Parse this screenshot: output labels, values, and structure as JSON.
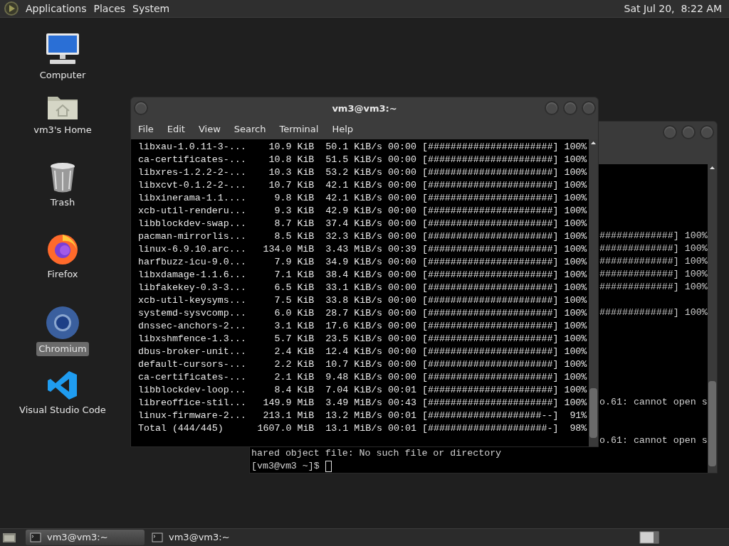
{
  "top_panel": {
    "menus": [
      "Applications",
      "Places",
      "System"
    ],
    "clock": "Sat Jul 20,  8:22 AM"
  },
  "desktop_icons": [
    {
      "label": "Computer",
      "kind": "computer",
      "selected": false
    },
    {
      "label": "vm3's Home",
      "kind": "home",
      "selected": false
    },
    {
      "label": "Trash",
      "kind": "trash",
      "selected": false
    },
    {
      "label": "Firefox",
      "kind": "firefox",
      "selected": false
    },
    {
      "label": "Chromium",
      "kind": "chromium",
      "selected": true
    },
    {
      "label": "Visual Studio Code",
      "kind": "vscode",
      "selected": false
    }
  ],
  "back_window": {
    "lines": [
      {
        "kind": "clipped",
        "text": "#############] 100%"
      },
      {
        "kind": "clipped",
        "text": "#############] 100%"
      },
      {
        "kind": "clipped",
        "text": "#############] 100%"
      },
      {
        "kind": "clipped",
        "text": "#############] 100%"
      },
      {
        "kind": "clipped",
        "text": "#############] 100%"
      },
      {
        "kind": "blank"
      },
      {
        "kind": "clipped",
        "text": "#############] 100%"
      },
      {
        "kind": "blank"
      },
      {
        "kind": "blank"
      },
      {
        "kind": "blank"
      },
      {
        "kind": "blank"
      },
      {
        "kind": "blank"
      },
      {
        "kind": "blank"
      },
      {
        "kind": "clipped",
        "text": "o.61: cannot open s"
      },
      {
        "kind": "blank"
      },
      {
        "kind": "blank"
      },
      {
        "kind": "clipped",
        "text": "o.61: cannot open s"
      },
      {
        "kind": "full",
        "text": "hared object file: No such file or directory"
      },
      {
        "kind": "prompt",
        "text": "[vm3@vm3 ~]$ "
      }
    ]
  },
  "front_window": {
    "title": "vm3@vm3:~",
    "menus": [
      "File",
      "Edit",
      "View",
      "Search",
      "Terminal",
      "Help"
    ],
    "rows": [
      {
        "name": "libxau-1.0.11-3-...",
        "size": "10.9 KiB",
        "rate": "50.1 KiB/s",
        "time": "00:00",
        "bar": "[######################]",
        "percent": "100%"
      },
      {
        "name": "ca-certificates-...",
        "size": "10.8 KiB",
        "rate": "51.5 KiB/s",
        "time": "00:00",
        "bar": "[######################]",
        "percent": "100%"
      },
      {
        "name": "libxres-1.2.2-2-...",
        "size": "10.3 KiB",
        "rate": "53.2 KiB/s",
        "time": "00:00",
        "bar": "[######################]",
        "percent": "100%"
      },
      {
        "name": "libxcvt-0.1.2-2-...",
        "size": "10.7 KiB",
        "rate": "42.1 KiB/s",
        "time": "00:00",
        "bar": "[######################]",
        "percent": "100%"
      },
      {
        "name": "libxinerama-1.1....",
        "size": "9.8 KiB",
        "rate": "42.1 KiB/s",
        "time": "00:00",
        "bar": "[######################]",
        "percent": "100%"
      },
      {
        "name": "xcb-util-renderu...",
        "size": "9.3 KiB",
        "rate": "42.9 KiB/s",
        "time": "00:00",
        "bar": "[######################]",
        "percent": "100%"
      },
      {
        "name": "libblockdev-swap...",
        "size": "8.7 KiB",
        "rate": "37.4 KiB/s",
        "time": "00:00",
        "bar": "[######################]",
        "percent": "100%"
      },
      {
        "name": "pacman-mirrorlis...",
        "size": "8.5 KiB",
        "rate": "32.3 KiB/s",
        "time": "00:00",
        "bar": "[######################]",
        "percent": "100%"
      },
      {
        "name": "linux-6.9.10.arc...",
        "size": "134.0 MiB",
        "rate": "3.43 MiB/s",
        "time": "00:39",
        "bar": "[######################]",
        "percent": "100%"
      },
      {
        "name": "harfbuzz-icu-9.0...",
        "size": "7.9 KiB",
        "rate": "34.9 KiB/s",
        "time": "00:00",
        "bar": "[######################]",
        "percent": "100%"
      },
      {
        "name": "libxdamage-1.1.6...",
        "size": "7.1 KiB",
        "rate": "38.4 KiB/s",
        "time": "00:00",
        "bar": "[######################]",
        "percent": "100%"
      },
      {
        "name": "libfakekey-0.3-3...",
        "size": "6.5 KiB",
        "rate": "33.1 KiB/s",
        "time": "00:00",
        "bar": "[######################]",
        "percent": "100%"
      },
      {
        "name": "xcb-util-keysyms...",
        "size": "7.5 KiB",
        "rate": "33.8 KiB/s",
        "time": "00:00",
        "bar": "[######################]",
        "percent": "100%"
      },
      {
        "name": "systemd-sysvcomp...",
        "size": "6.0 KiB",
        "rate": "28.7 KiB/s",
        "time": "00:00",
        "bar": "[######################]",
        "percent": "100%"
      },
      {
        "name": "dnssec-anchors-2...",
        "size": "3.1 KiB",
        "rate": "17.6 KiB/s",
        "time": "00:00",
        "bar": "[######################]",
        "percent": "100%"
      },
      {
        "name": "libxshmfence-1.3...",
        "size": "5.7 KiB",
        "rate": "23.5 KiB/s",
        "time": "00:00",
        "bar": "[######################]",
        "percent": "100%"
      },
      {
        "name": "dbus-broker-unit...",
        "size": "2.4 KiB",
        "rate": "12.4 KiB/s",
        "time": "00:00",
        "bar": "[######################]",
        "percent": "100%"
      },
      {
        "name": "default-cursors-...",
        "size": "2.2 KiB",
        "rate": "10.7 KiB/s",
        "time": "00:00",
        "bar": "[######################]",
        "percent": "100%"
      },
      {
        "name": "ca-certificates-...",
        "size": "2.1 KiB",
        "rate": "9.48 KiB/s",
        "time": "00:00",
        "bar": "[######################]",
        "percent": "100%"
      },
      {
        "name": "libblockdev-loop...",
        "size": "8.4 KiB",
        "rate": "7.04 KiB/s",
        "time": "00:01",
        "bar": "[######################]",
        "percent": "100%"
      },
      {
        "name": "libreoffice-stil...",
        "size": "149.9 MiB",
        "rate": "3.49 MiB/s",
        "time": "00:43",
        "bar": "[######################]",
        "percent": "100%"
      },
      {
        "name": "linux-firmware-2...",
        "size": "213.1 MiB",
        "rate": "13.2 MiB/s",
        "time": "00:01",
        "bar": "[####################--]",
        "percent": "91%"
      },
      {
        "name": "Total (444/445)",
        "size": "1607.0 MiB",
        "rate": "13.1 MiB/s",
        "time": "00:01",
        "bar": "[#####################-]",
        "percent": "98%"
      }
    ]
  },
  "taskbar": {
    "tasks": [
      {
        "label": "vm3@vm3:~",
        "selected": true
      },
      {
        "label": "vm3@vm3:~",
        "selected": false
      }
    ]
  }
}
